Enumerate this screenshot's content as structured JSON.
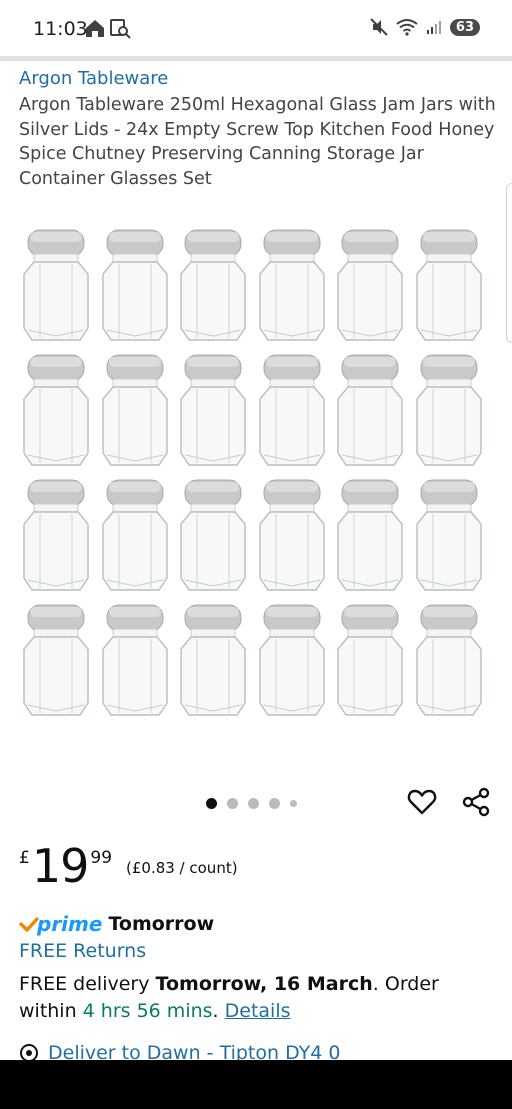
{
  "status_bar": {
    "time": "11:03",
    "battery": "63"
  },
  "product": {
    "brand": "Argon Tableware",
    "title": "Argon Tableware 250ml Hexagonal Glass Jam Jars with Silver Lids - 24x Empty Screw Top Kitchen Food Honey Spice Chutney Preserving Canning Storage Jar Container Glasses Set"
  },
  "gallery": {
    "image_count": 5,
    "active_index": 0,
    "jar_rows": 4,
    "jar_columns": 6
  },
  "price": {
    "symbol": "£",
    "whole": "19",
    "fraction": "99",
    "unit_price": "(£0.83 / count)"
  },
  "prime": {
    "check_mark": "✓",
    "label": "prime",
    "day": "Tomorrow"
  },
  "returns": {
    "label": "FREE Returns"
  },
  "delivery": {
    "prefix": "FREE delivery ",
    "date": "Tomorrow, 16 March",
    "order_text": ". Order within ",
    "countdown": "4 hrs 56 mins",
    "period": ". ",
    "details_link": "Details"
  },
  "location": {
    "label": "Deliver to Dawn - Tipton DY4 0"
  },
  "colors": {
    "link": "#1e6fa3",
    "countdown": "#067d62",
    "prime": "#1a98ff",
    "prime_check": "#f08804"
  },
  "icons": [
    "home-icon",
    "screen-search-icon",
    "mute-icon",
    "wifi-icon",
    "signal-icon",
    "heart-icon",
    "share-icon",
    "location-pin-icon"
  ]
}
